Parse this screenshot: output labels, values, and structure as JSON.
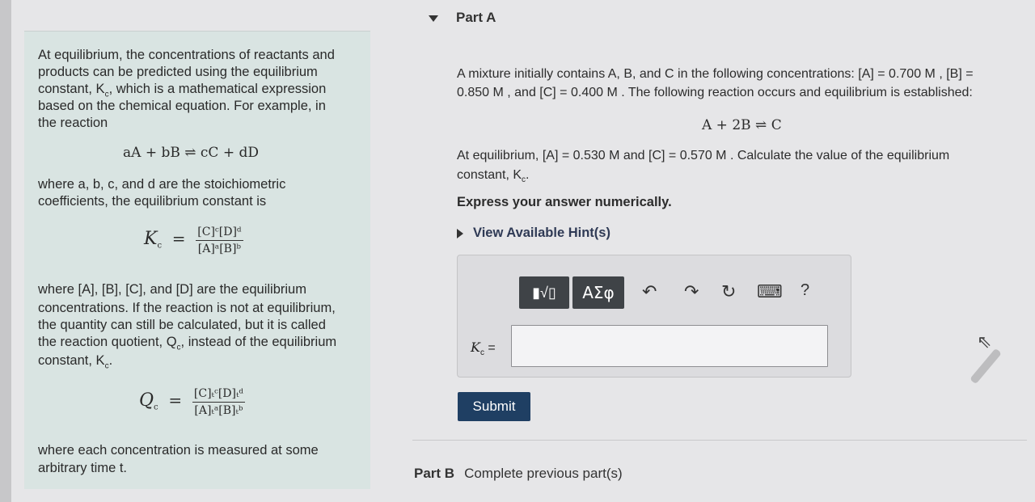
{
  "left_card": {
    "intro_lines": [
      "At equilibrium, the concentrations of reactants and",
      "products can be predicted using the equilibrium",
      "constant, K",
      "based on the chemical equation. For example, in",
      "the reaction"
    ],
    "intro_line3_rest": ", which is a mathematical expression",
    "general_reaction": "aA + bB ⇌ cC + dD",
    "where_line1": "where a, b, c, and d are the stoichiometric",
    "where_line2": "coefficients, the equilibrium constant is",
    "kc_numerator": "[C]ᶜ[D]ᵈ",
    "kc_denominator": "[A]ᵃ[B]ᵇ",
    "para2": [
      "where [A], [B], [C], and [D] are the equilibrium",
      "concentrations. If the reaction is not at equilibrium,",
      "the quantity can still be calculated, but it is called",
      "the reaction quotient, Q",
      "constant, K"
    ],
    "para2_line4_rest": ", instead of the equilibrium",
    "qc_numerator": "[C]ₜᶜ[D]ₜᵈ",
    "qc_denominator": "[A]ₜᵃ[B]ₜᵇ",
    "final_lines": [
      "where each concentration is measured at some",
      "arbitrary time t."
    ]
  },
  "part_a": {
    "title": "Part A",
    "problem_line1": "A mixture initially contains A, B, and C in the following concentrations: [A] = 0.700 M , [B] =",
    "problem_line2": "0.850 M , and [C] = 0.400 M . The following reaction occurs and equilibrium is established:",
    "reaction": "A + 2B ⇌ C",
    "eq_line1": "At equilibrium, [A] = 0.530 M and [C] = 0.570 M . Calculate the value of the equilibrium",
    "eq_line2": "constant, K",
    "instruction": "Express your answer numerically.",
    "hint_link": "View Available Hint(s)",
    "toolbar": {
      "template_button": "▮√▯",
      "symbols_button": "ΑΣφ",
      "undo_icon": "↶",
      "redo_icon": "↷",
      "reset_icon": "↻",
      "keyboard_icon": "⌨",
      "help_label": "?"
    },
    "answer_label": "K",
    "answer_value": "",
    "submit_label": "Submit"
  },
  "part_b": {
    "title": "Part B",
    "status": "Complete previous part(s)"
  }
}
